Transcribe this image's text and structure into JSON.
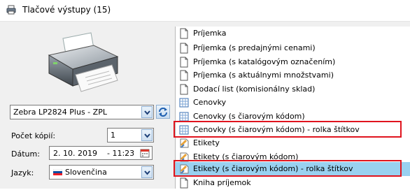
{
  "window": {
    "title": "Tlačové výstupy  (15)"
  },
  "printer": {
    "selected": "Zebra LP2824 Plus - ZPL"
  },
  "copies": {
    "label": "Počet kópií:",
    "value": "1"
  },
  "date": {
    "label": "Dátum:",
    "date": "2. 10. 2019",
    "time": "- 11:23"
  },
  "language": {
    "label": "Jazyk:",
    "value": "Slovenčina"
  },
  "outputs": [
    {
      "label": "Príjemka",
      "icon": "document-icon"
    },
    {
      "label": "Príjemka (s predajnými cenami)",
      "icon": "document-icon"
    },
    {
      "label": "Príjemka (s katalógovým označením)",
      "icon": "document-icon"
    },
    {
      "label": "Príjemka (s aktuálnymi množstvami)",
      "icon": "document-icon"
    },
    {
      "label": "Dodací list (komisionálny sklad)",
      "icon": "document-icon"
    },
    {
      "label": "Cenovky",
      "icon": "grid-icon"
    },
    {
      "label": "Cenovky (s čiarovým kódom)",
      "icon": "grid-icon"
    },
    {
      "label": "Cenovky (s čiarovým kódom) - rolka štítkov",
      "icon": "grid-icon"
    },
    {
      "label": "Etikety",
      "icon": "label-icon"
    },
    {
      "label": "Etikety (s čiarovým kódom)",
      "icon": "label-icon"
    },
    {
      "label": "Etikety (s čiarovým kódom) - rolka štítkov",
      "icon": "label-icon"
    },
    {
      "label": "Kniha príjemok",
      "icon": "document-icon"
    }
  ],
  "colors": {
    "highlight": "#e0141e",
    "selection": "#99d1f0"
  }
}
